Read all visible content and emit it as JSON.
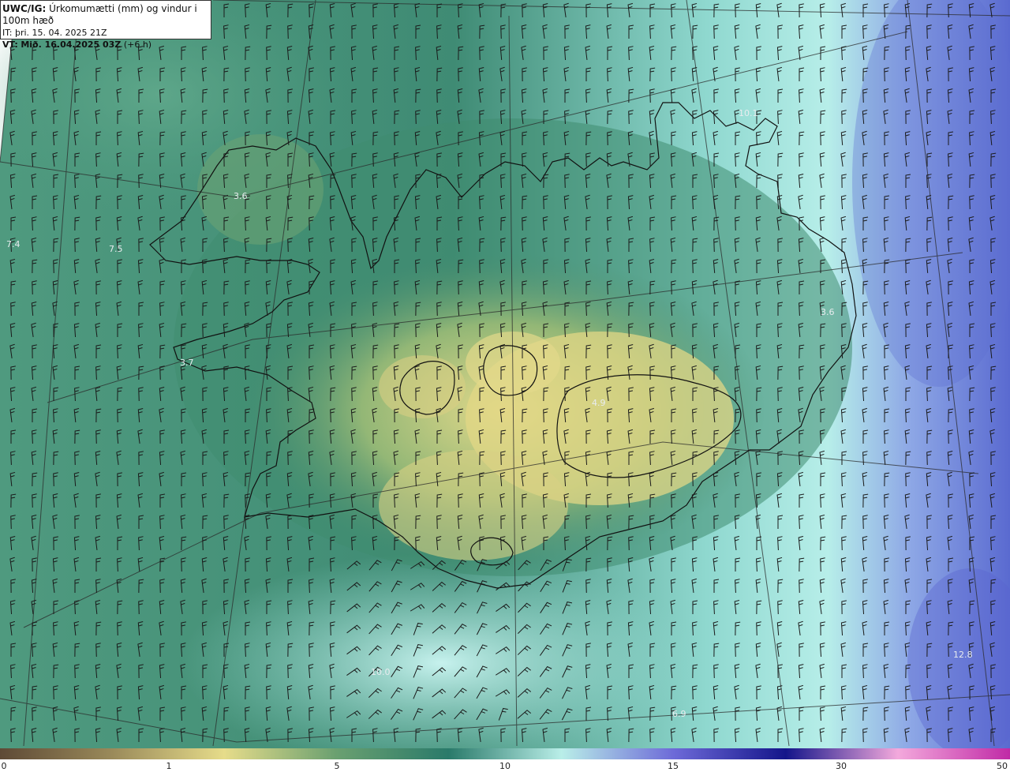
{
  "header": {
    "model": "UWC/IG:",
    "title": "Úrkomumætti (mm) og vindur i 100m hæð",
    "it_label": "IT:",
    "it_value": "þri. 15. 04. 2025 21Z",
    "vt_label": "VT:",
    "vt_value": "Mið. 16.04.2025 03Z",
    "vt_offset": "(+6 h)"
  },
  "map_labels": [
    {
      "id": "val-west-1",
      "text": "7.4"
    },
    {
      "id": "val-west-2",
      "text": "7.5"
    },
    {
      "id": "val-westfjords",
      "text": "3.6"
    },
    {
      "id": "val-snaefells",
      "text": "3.7"
    },
    {
      "id": "val-north",
      "text": "10.1"
    },
    {
      "id": "val-eastfjords",
      "text": "3.6"
    },
    {
      "id": "val-highland",
      "text": "4.9"
    },
    {
      "id": "val-southeast",
      "text": "12.8"
    },
    {
      "id": "val-south",
      "text": "10.0"
    },
    {
      "id": "val-south-2",
      "text": "6.9"
    }
  ],
  "colorbar": {
    "ticks": [
      "0",
      "1",
      "5",
      "10",
      "15",
      "30",
      "50"
    ],
    "colors": [
      "#5e4a36",
      "#9a8a5a",
      "#e6dc8a",
      "#6aa070",
      "#2a7a6a",
      "#b9eee8",
      "#6d6ad8",
      "#14158a",
      "#f3a9dc",
      "#c02aa6"
    ]
  },
  "colors": {
    "land_outline": "#111111",
    "grid_line": "#2a2a2a",
    "barb": "#1a1a1a"
  }
}
